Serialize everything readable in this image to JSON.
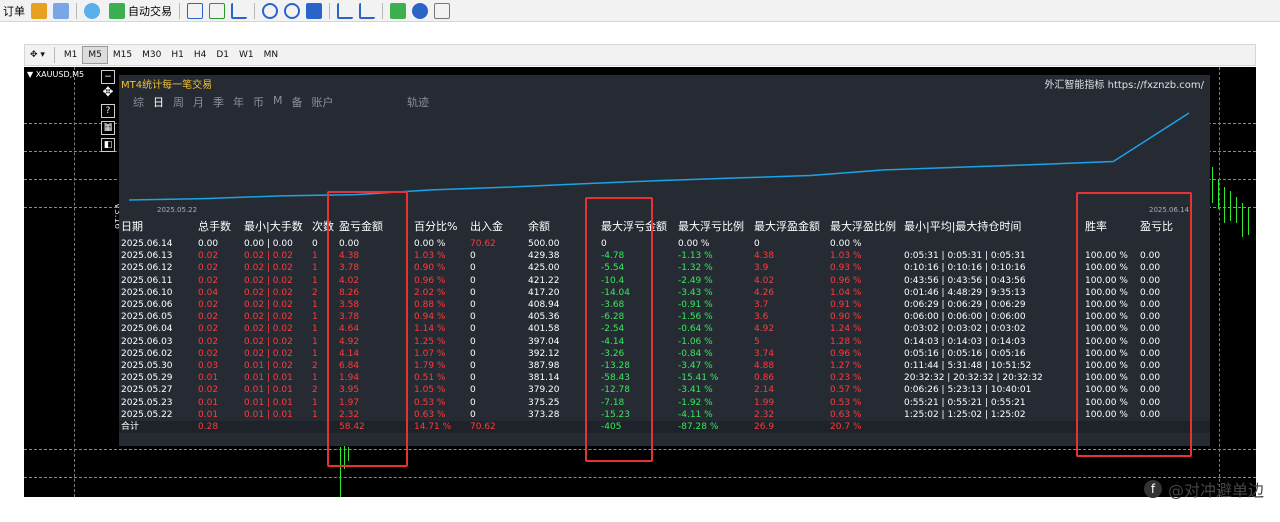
{
  "toolbar": {
    "items": [
      "订单",
      "自动交易"
    ]
  },
  "timeframes": {
    "items": [
      "M1",
      "M5",
      "M15",
      "M30",
      "H1",
      "H4",
      "D1",
      "W1",
      "MN"
    ],
    "active": "M5"
  },
  "chart": {
    "symbol": "▼ XAUUSD,M5",
    "vertical_label": "V3.16"
  },
  "panel": {
    "title": "MT4统计每一笔交易",
    "brand": "外汇智能指标 https://fxznzb.com/",
    "tabs": [
      "综",
      "日",
      "周",
      "月",
      "季",
      "年",
      "币",
      "M",
      "备",
      "账户"
    ],
    "active_tab": "日",
    "track_label": "轨迹",
    "date_start": "2025.05.22",
    "date_end": "2025.06.14",
    "headers": [
      "日期",
      "总手数",
      "最小|大手数",
      "次数",
      "盈亏金额",
      "百分比%",
      "出入金",
      "余额",
      "最大浮亏金额",
      "最大浮亏比例",
      "最大浮盈金额",
      "最大浮盈比例",
      "最小|平均|最大持仓时间",
      "胜率",
      "盈亏比"
    ],
    "rows": [
      [
        "2025.06.14",
        "0.00",
        "0.00 | 0.00",
        "0",
        "0.00",
        "0.00 %",
        "70.62",
        "500.00",
        "0",
        "0.00 %",
        "0",
        "0.00 %",
        "",
        "",
        ""
      ],
      [
        "2025.06.13",
        "0.02",
        "0.02 | 0.02",
        "1",
        "4.38",
        "1.03 %",
        "0",
        "429.38",
        "-4.78",
        "-1.13 %",
        "4.38",
        "1.03 %",
        "0:05:31 | 0:05:31 | 0:05:31",
        "100.00 %",
        "0.00"
      ],
      [
        "2025.06.12",
        "0.02",
        "0.02 | 0.02",
        "1",
        "3.78",
        "0.90 %",
        "0",
        "425.00",
        "-5.54",
        "-1.32 %",
        "3.9",
        "0.93 %",
        "0:10:16 | 0:10:16 | 0:10:16",
        "100.00 %",
        "0.00"
      ],
      [
        "2025.06.11",
        "0.02",
        "0.02 | 0.02",
        "1",
        "4.02",
        "0.96 %",
        "0",
        "421.22",
        "-10.4",
        "-2.49 %",
        "4.02",
        "0.96 %",
        "0:43:56 | 0:43:56 | 0:43:56",
        "100.00 %",
        "0.00"
      ],
      [
        "2025.06.10",
        "0.04",
        "0.02 | 0.02",
        "2",
        "8.26",
        "2.02 %",
        "0",
        "417.20",
        "-14.04",
        "-3.43 %",
        "4.26",
        "1.04 %",
        "0:01:46 | 4:48:29 | 9:35:13",
        "100.00 %",
        "0.00"
      ],
      [
        "2025.06.06",
        "0.02",
        "0.02 | 0.02",
        "1",
        "3.58",
        "0.88 %",
        "0",
        "408.94",
        "-3.68",
        "-0.91 %",
        "3.7",
        "0.91 %",
        "0:06:29 | 0:06:29 | 0:06:29",
        "100.00 %",
        "0.00"
      ],
      [
        "2025.06.05",
        "0.02",
        "0.02 | 0.02",
        "1",
        "3.78",
        "0.94 %",
        "0",
        "405.36",
        "-6.28",
        "-1.56 %",
        "3.6",
        "0.90 %",
        "0:06:00 | 0:06:00 | 0:06:00",
        "100.00 %",
        "0.00"
      ],
      [
        "2025.06.04",
        "0.02",
        "0.02 | 0.02",
        "1",
        "4.64",
        "1.14 %",
        "0",
        "401.58",
        "-2.54",
        "-0.64 %",
        "4.92",
        "1.24 %",
        "0:03:02 | 0:03:02 | 0:03:02",
        "100.00 %",
        "0.00"
      ],
      [
        "2025.06.03",
        "0.02",
        "0.02 | 0.02",
        "1",
        "4.92",
        "1.25 %",
        "0",
        "397.04",
        "-4.14",
        "-1.06 %",
        "5",
        "1.28 %",
        "0:14:03 | 0:14:03 | 0:14:03",
        "100.00 %",
        "0.00"
      ],
      [
        "2025.06.02",
        "0.02",
        "0.02 | 0.02",
        "1",
        "4.14",
        "1.07 %",
        "0",
        "392.12",
        "-3.26",
        "-0.84 %",
        "3.74",
        "0.96 %",
        "0:05:16 | 0:05:16 | 0:05:16",
        "100.00 %",
        "0.00"
      ],
      [
        "2025.05.30",
        "0.03",
        "0.01 | 0.02",
        "2",
        "6.84",
        "1.79 %",
        "0",
        "387.98",
        "-13.28",
        "-3.47 %",
        "4.88",
        "1.27 %",
        "0:11:44 | 5:31:48 | 10:51:52",
        "100.00 %",
        "0.00"
      ],
      [
        "2025.05.29",
        "0.01",
        "0.01 | 0.01",
        "1",
        "1.94",
        "0.51 %",
        "0",
        "381.14",
        "-58.43",
        "-15.41 %",
        "0.86",
        "0.23 %",
        "20:32:32 | 20:32:32 | 20:32:32",
        "100.00 %",
        "0.00"
      ],
      [
        "2025.05.27",
        "0.02",
        "0.01 | 0.01",
        "2",
        "3.95",
        "1.05 %",
        "0",
        "379.20",
        "-12.78",
        "-3.41 %",
        "2.14",
        "0.57 %",
        "0:06:26 | 5:23:13 | 10:40:01",
        "100.00 %",
        "0.00"
      ],
      [
        "2025.05.23",
        "0.01",
        "0.01 | 0.01",
        "1",
        "1.97",
        "0.53 %",
        "0",
        "375.25",
        "-7.18",
        "-1.92 %",
        "1.99",
        "0.53 %",
        "0:55:21 | 0:55:21 | 0:55:21",
        "100.00 %",
        "0.00"
      ],
      [
        "2025.05.22",
        "0.01",
        "0.01 | 0.01",
        "1",
        "2.32",
        "0.63 %",
        "0",
        "373.28",
        "-15.23",
        "-4.11 %",
        "2.32",
        "0.63 %",
        "1:25:02 | 1:25:02 | 1:25:02",
        "100.00 %",
        "0.00"
      ]
    ],
    "total": [
      "合计",
      "0.28",
      "",
      "",
      "58.42",
      "14.71 %",
      "70.62",
      "",
      "-405",
      "-87.28 %",
      "26.9",
      "20.7 %",
      "",
      "",
      ""
    ]
  },
  "equity_curve": [
    373.28,
    375.25,
    379.2,
    381.14,
    387.98,
    392.12,
    397.04,
    401.58,
    405.36,
    408.94,
    417.2,
    421.22,
    425.0,
    429.38,
    500.0
  ],
  "watermark": "@对冲避单边",
  "colors": {
    "panel_bg": "#262b33",
    "loss": "#38e85c",
    "profit": "#ff3a3a",
    "curve": "#1aa3e8",
    "title": "#f0c030",
    "highlight": "#e53333"
  }
}
